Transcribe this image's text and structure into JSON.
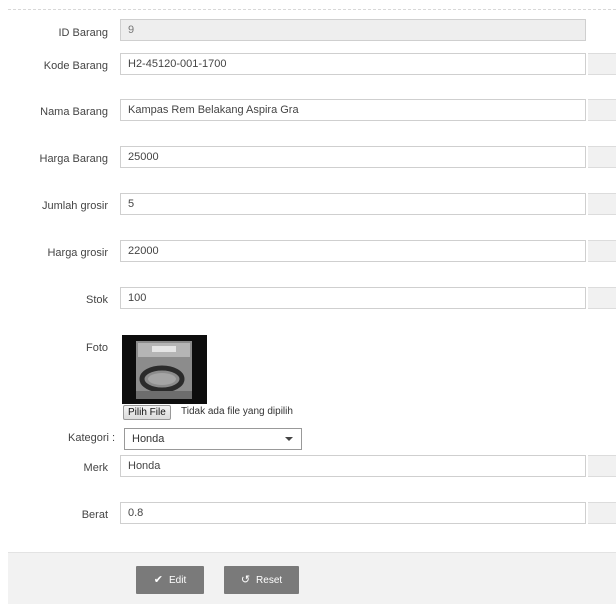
{
  "form": {
    "id_label": "ID Barang",
    "id_value": "9",
    "kode_label": "Kode Barang",
    "kode_value": "H2-45120-001-1700",
    "nama_label": "Nama Barang",
    "nama_value": "Kampas Rem Belakang Aspira Gra",
    "harga_label": "Harga Barang",
    "harga_value": "25000",
    "jumlah_label": "Jumlah grosir",
    "jumlah_value": "5",
    "hgrosir_label": "Harga grosir",
    "hgrosir_value": "22000",
    "stok_label": "Stok",
    "stok_value": "100",
    "foto_label": "Foto",
    "file_button": "Pilih File",
    "file_status": "Tidak ada file yang dipilih",
    "kategori_label": "Kategori :",
    "kategori_value": "Honda",
    "merk_label": "Merk",
    "merk_value": "Honda",
    "berat_label": "Berat",
    "berat_value": "0.8"
  },
  "actions": {
    "edit_label": "Edit",
    "reset_label": "Reset"
  },
  "icons": {
    "edit": "check-icon",
    "reset": "undo-icon"
  }
}
